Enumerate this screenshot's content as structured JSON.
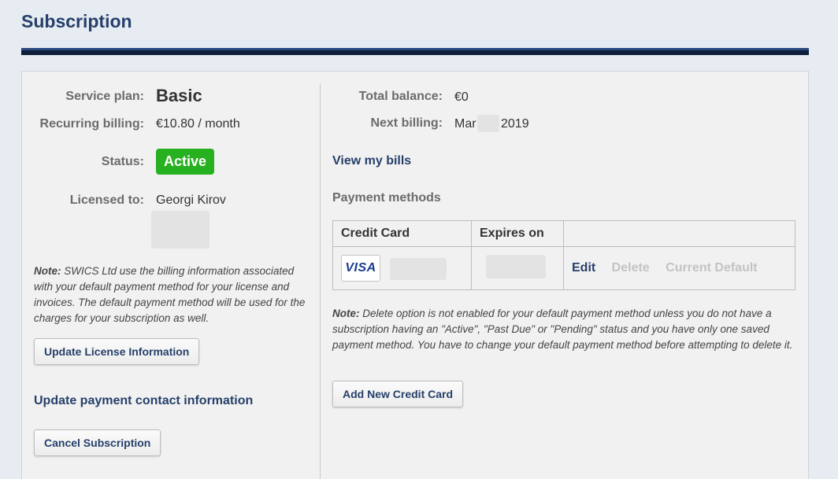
{
  "page": {
    "title": "Subscription"
  },
  "left": {
    "service_plan_label": "Service plan:",
    "service_plan_value": "Basic",
    "recurring_billing_label": "Recurring billing:",
    "recurring_billing_value": "€10.80 / month",
    "status_label": "Status:",
    "status_value": "Active",
    "licensed_to_label": "Licensed to:",
    "licensed_to_value": "Georgi Kirov",
    "note_prefix": "Note:",
    "note_text": " SWICS Ltd use the billing information associated with your default payment method for your license and invoices. The default payment method will be used for the charges for your subscription as well.",
    "update_license_button": "Update License Information",
    "update_payment_contact_link": "Update payment contact information",
    "cancel_subscription_button": "Cancel Subscription"
  },
  "right": {
    "total_balance_label": "Total balance:",
    "total_balance_value": "€0",
    "next_billing_label": "Next billing:",
    "next_billing_month": "Mar",
    "next_billing_year": "2019",
    "view_bills_link": "View my bills",
    "payment_methods_heading": "Payment methods",
    "table": {
      "headers": [
        "Credit Card",
        "Expires on",
        ""
      ],
      "rows": [
        {
          "card_brand": "VISA",
          "actions": {
            "edit": "Edit",
            "delete": "Delete",
            "default": "Current Default"
          }
        }
      ]
    },
    "note_prefix": "Note:",
    "note_text": " Delete option is not enabled for your default payment method unless you do not have a subscription having an \"Active\", \"Past Due\" or \"Pending\" status and you have only one saved payment method. You have to change your default payment method before attempting to delete it.",
    "add_card_button": "Add New Credit Card"
  },
  "colors": {
    "accent": "#26406b",
    "status_active": "#27b020",
    "disabled": "#c3c3c3",
    "background": "#e7ebf2",
    "panel": "#f1f1f1"
  }
}
